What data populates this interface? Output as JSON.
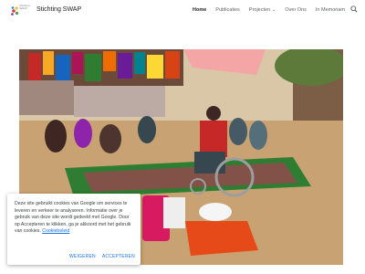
{
  "header": {
    "logo_text": "Stichting SWAP",
    "site_title": "Stichting SWAP",
    "nav": [
      "Home",
      "Publicaties",
      "Projecten",
      "Over Ons",
      "In Memoriam"
    ],
    "active_nav": "Home",
    "search_icon": "search-icon"
  },
  "hero": {
    "description": "Photo: a woman in a wheelchair beside a colourful mat on sandy ground, surrounded by villagers under a tree with drying laundry."
  },
  "cookie": {
    "text": "Deze site gebruikt cookies van Google om services te leveren en verkeer te analyseren. Informatie over je gebruik van deze site wordt gedeeld met Google. Door op Accepteren te klikken, ga je akkoord met het gebruik van cookies. ",
    "link": "Cookiebeleid",
    "decline": "WEIGEREN",
    "accept": "ACCEPTEREN"
  },
  "colors": {
    "accent": "#1a73e8",
    "text": "#202124",
    "muted": "#5f6368"
  }
}
